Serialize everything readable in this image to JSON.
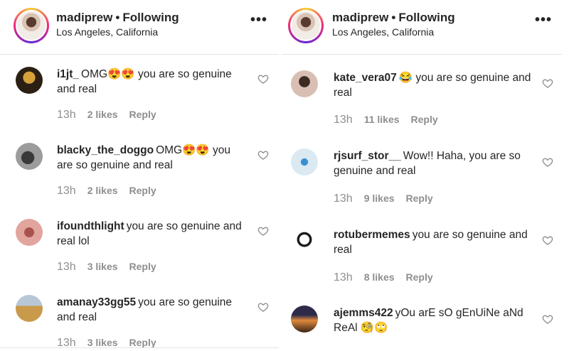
{
  "colors": {
    "text": "#262626",
    "muted": "#8e8e8e",
    "divider": "#e3e3e3"
  },
  "left": {
    "header": {
      "username": "madiprew",
      "separator": "•",
      "status": "Following",
      "location": "Los Angeles, California",
      "more": "•••"
    },
    "comments": [
      {
        "user": "i1jt_",
        "text": "OMG😍😍 you are so genuine and real",
        "time": "13h",
        "likes": "2 likes",
        "reply": "Reply"
      },
      {
        "user": "blacky_the_doggo",
        "text": "OMG😍😍 you are so genuine and real",
        "time": "13h",
        "likes": "2 likes",
        "reply": "Reply"
      },
      {
        "user": "ifoundthlight",
        "text": "you are so genuine and real lol",
        "time": "13h",
        "likes": "3 likes",
        "reply": "Reply"
      },
      {
        "user": "amanay33gg55",
        "text": "you are so genuine and real",
        "time": "13h",
        "likes": "3 likes",
        "reply": "Reply"
      }
    ]
  },
  "right": {
    "header": {
      "username": "madiprew",
      "separator": "•",
      "status": "Following",
      "location": "Los Angeles, California",
      "more": "•••"
    },
    "comments": [
      {
        "user": "kate_vera07",
        "text": "😂 you are so genuine and real",
        "time": "13h",
        "likes": "11 likes",
        "reply": "Reply"
      },
      {
        "user": "rjsurf_stor__",
        "text": "Wow!! Haha, you are so genuine and real",
        "time": "13h",
        "likes": "9 likes",
        "reply": "Reply"
      },
      {
        "user": "rotubermemes",
        "text": "you are so genuine and real",
        "time": "13h",
        "likes": "8 likes",
        "reply": "Reply"
      },
      {
        "user": "ajemms422",
        "text": "yOu arE sO gEnUiNe aNd ReAl 🧐🙄",
        "time": "",
        "likes": "",
        "reply": ""
      }
    ]
  }
}
